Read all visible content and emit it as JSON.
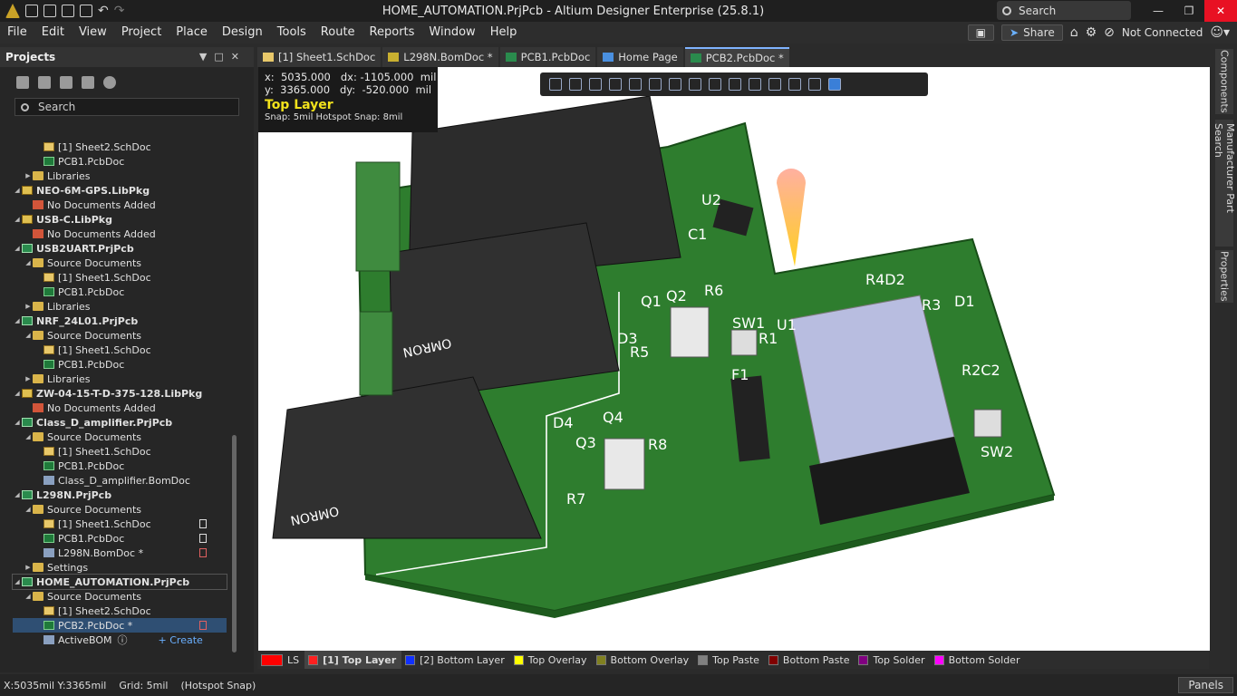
{
  "window": {
    "title": "HOME_AUTOMATION.PrjPcb - Altium Designer Enterprise (25.8.1)",
    "search_placeholder": "Search"
  },
  "menu": {
    "items": [
      "File",
      "Edit",
      "View",
      "Project",
      "Place",
      "Design",
      "Tools",
      "Route",
      "Reports",
      "Window",
      "Help"
    ],
    "share_label": "Share",
    "connection_label": "Not Connected"
  },
  "projects_panel": {
    "title": "Projects",
    "search_placeholder": "Search",
    "tree": [
      {
        "label": "[1] Sheet2.SchDoc",
        "level": 3,
        "icon": "sch"
      },
      {
        "label": "PCB1.PcbDoc",
        "level": 3,
        "icon": "pcb"
      },
      {
        "label": "Libraries",
        "level": 2,
        "icon": "folder",
        "exp": "collapsed"
      },
      {
        "label": "NEO-6M-GPS.LibPkg",
        "level": 1,
        "icon": "lib",
        "exp": "expanded",
        "bold": true
      },
      {
        "label": "No Documents Added",
        "level": 2,
        "icon": "red"
      },
      {
        "label": "USB-C.LibPkg",
        "level": 1,
        "icon": "lib",
        "exp": "expanded",
        "bold": true
      },
      {
        "label": "No Documents Added",
        "level": 2,
        "icon": "red"
      },
      {
        "label": "USB2UART.PrjPcb",
        "level": 1,
        "icon": "proj",
        "exp": "expanded",
        "bold": true
      },
      {
        "label": "Source Documents",
        "level": 2,
        "icon": "folder",
        "exp": "expanded"
      },
      {
        "label": "[1] Sheet1.SchDoc",
        "level": 3,
        "icon": "sch"
      },
      {
        "label": "PCB1.PcbDoc",
        "level": 3,
        "icon": "pcb"
      },
      {
        "label": "Libraries",
        "level": 2,
        "icon": "folder",
        "exp": "collapsed"
      },
      {
        "label": "NRF_24L01.PrjPcb",
        "level": 1,
        "icon": "proj",
        "exp": "expanded",
        "bold": true
      },
      {
        "label": "Source Documents",
        "level": 2,
        "icon": "folder",
        "exp": "expanded"
      },
      {
        "label": "[1] Sheet1.SchDoc",
        "level": 3,
        "icon": "sch"
      },
      {
        "label": "PCB1.PcbDoc",
        "level": 3,
        "icon": "pcb"
      },
      {
        "label": "Libraries",
        "level": 2,
        "icon": "folder",
        "exp": "collapsed"
      },
      {
        "label": "ZW-04-15-T-D-375-128.LibPkg",
        "level": 1,
        "icon": "lib",
        "exp": "expanded",
        "bold": true
      },
      {
        "label": "No Documents Added",
        "level": 2,
        "icon": "red"
      },
      {
        "label": "Class_D_amplifier.PrjPcb",
        "level": 1,
        "icon": "proj",
        "exp": "expanded",
        "bold": true
      },
      {
        "label": "Source Documents",
        "level": 2,
        "icon": "folder",
        "exp": "expanded"
      },
      {
        "label": "[1] Sheet1.SchDoc",
        "level": 3,
        "icon": "sch"
      },
      {
        "label": "PCB1.PcbDoc",
        "level": 3,
        "icon": "pcb"
      },
      {
        "label": "Class_D_amplifier.BomDoc",
        "level": 3,
        "icon": "bom"
      },
      {
        "label": "L298N.PrjPcb",
        "level": 1,
        "icon": "proj",
        "exp": "expanded",
        "bold": true
      },
      {
        "label": "Source Documents",
        "level": 2,
        "icon": "folder",
        "exp": "expanded"
      },
      {
        "label": "[1] Sheet1.SchDoc",
        "level": 3,
        "icon": "sch",
        "doc": "plain"
      },
      {
        "label": "PCB1.PcbDoc",
        "level": 3,
        "icon": "pcb",
        "doc": "plain"
      },
      {
        "label": "L298N.BomDoc *",
        "level": 3,
        "icon": "bom",
        "doc": "mod"
      },
      {
        "label": "Settings",
        "level": 2,
        "icon": "folder",
        "exp": "collapsed"
      },
      {
        "label": "HOME_AUTOMATION.PrjPcb",
        "level": 1,
        "icon": "proj",
        "exp": "expanded",
        "bold": true,
        "hl": true
      },
      {
        "label": "Source Documents",
        "level": 2,
        "icon": "folder",
        "exp": "expanded"
      },
      {
        "label": "[1] Sheet2.SchDoc",
        "level": 3,
        "icon": "sch"
      },
      {
        "label": "PCB2.PcbDoc *",
        "level": 3,
        "icon": "pcb",
        "sel": true,
        "doc": "mod"
      },
      {
        "label": "ActiveBOM",
        "level": 3,
        "icon": "bom",
        "extra": "+ Create"
      }
    ]
  },
  "tabs": [
    {
      "label": "[1] Sheet1.SchDoc",
      "icon": "sch"
    },
    {
      "label": "L298N.BomDoc *",
      "icon": "bom"
    },
    {
      "label": "PCB1.PcbDoc",
      "icon": "pcb"
    },
    {
      "label": "Home Page",
      "icon": "home"
    },
    {
      "label": "PCB2.PcbDoc *",
      "icon": "pcb",
      "active": true
    }
  ],
  "coords": {
    "x": "x:  5035.000",
    "dx": "dx: -1105.000  mil",
    "y": "y:  3365.000",
    "dy": "dy:  -520.000  mil",
    "layer": "Top Layer",
    "snap": "Snap: 5mil Hotspot Snap: 8mil"
  },
  "silkscreen": [
    "U2",
    "C1",
    "R6",
    "Q2",
    "Q1",
    "D3",
    "R5",
    "SW1",
    "U1",
    "R1",
    "F1",
    "R4D2",
    "R3",
    "D1",
    "R2C2",
    "SW2",
    "D4",
    "Q4",
    "Q3",
    "R8",
    "R7",
    "OMRON",
    "OMRON"
  ],
  "layers": [
    {
      "label": "LS",
      "color": "#ff0000"
    },
    {
      "label": "[1] Top Layer",
      "color": "#ff2020",
      "current": true
    },
    {
      "label": "[2] Bottom Layer",
      "color": "#1030ff"
    },
    {
      "label": "Top Overlay",
      "color": "#ffff00"
    },
    {
      "label": "Bottom Overlay",
      "color": "#808020"
    },
    {
      "label": "Top Paste",
      "color": "#808080"
    },
    {
      "label": "Bottom Paste",
      "color": "#800000"
    },
    {
      "label": "Top Solder",
      "color": "#800080"
    },
    {
      "label": "Bottom Solder",
      "color": "#ff00ff"
    }
  ],
  "status": {
    "pos": "X:5035mil Y:3365mil",
    "grid": "Grid: 5mil",
    "snap": "(Hotspot Snap)",
    "panels": "Panels"
  },
  "right_rail": [
    "Components",
    "Manufacturer Part Search",
    "Properties"
  ]
}
